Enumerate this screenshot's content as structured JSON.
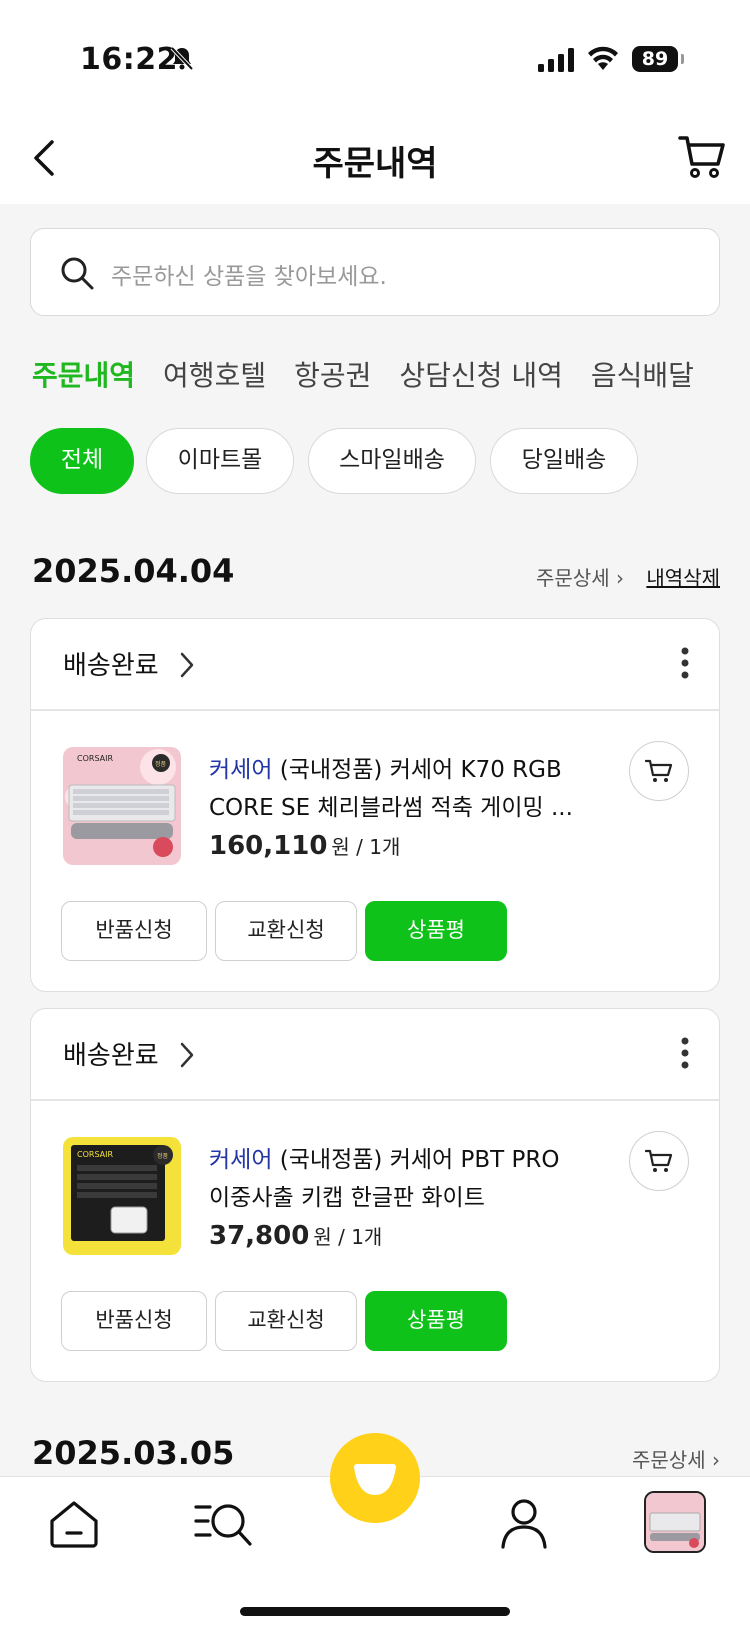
{
  "status_bar": {
    "time": "16:22",
    "battery": "89"
  },
  "header": {
    "title": "주문내역"
  },
  "search": {
    "placeholder": "주문하신 상품을 찾아보세요."
  },
  "tabs": [
    {
      "label": "주문내역",
      "active": true
    },
    {
      "label": "여행호텔"
    },
    {
      "label": "항공권"
    },
    {
      "label": "상담신청 내역"
    },
    {
      "label": "음식배달"
    }
  ],
  "chips": [
    {
      "label": "전체",
      "active": true
    },
    {
      "label": "이마트몰"
    },
    {
      "label": "스마일배송"
    },
    {
      "label": "당일배송"
    }
  ],
  "order_groups": [
    {
      "date": "2025.04.04",
      "detail_link": "주문상세 ›",
      "delete_link": "내역삭제",
      "orders": [
        {
          "status": "배송완료",
          "brand": "커세어",
          "title_line1": " (국내정품) 커세어 K70 RGB",
          "title_line2": "CORE SE 체리블라썸 적축 게이밍 ...",
          "price": "160,110",
          "price_suffix": "원 / 1개",
          "buttons": [
            "반품신청",
            "교환신청",
            "상품평"
          ]
        },
        {
          "status": "배송완료",
          "brand": "커세어",
          "title_line1": " (국내정품) 커세어 PBT PRO",
          "title_line2": "이중사출 키캡 한글판 화이트",
          "price": "37,800",
          "price_suffix": "원 / 1개",
          "buttons": [
            "반품신청",
            "교환신청",
            "상품평"
          ]
        }
      ]
    },
    {
      "date": "2025.03.05",
      "detail_link": "주문상세 ›"
    }
  ],
  "product_images": [
    {
      "brand_mark": "CORSAIR",
      "badge": "정품"
    },
    {
      "brand_mark": "CORSAIR",
      "badge": "정품"
    }
  ],
  "colors": {
    "accent_green": "#0fc21a",
    "brand_blue": "#2336a8",
    "center_yellow": "#ffd119"
  }
}
